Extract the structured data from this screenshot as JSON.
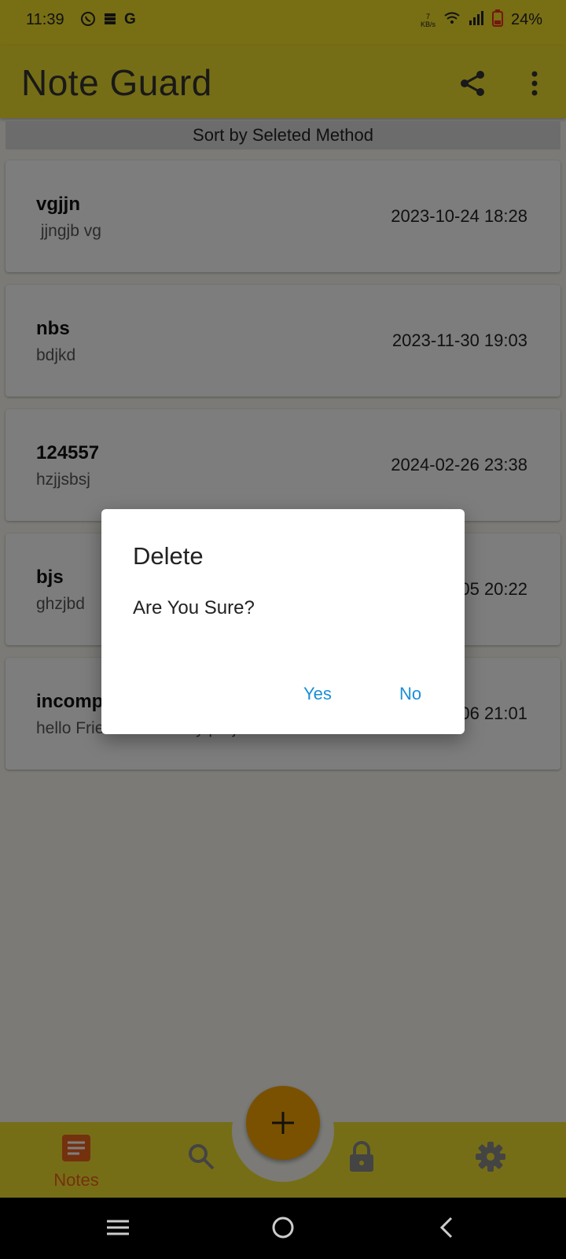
{
  "status_bar": {
    "time": "11:39",
    "left_icons": [
      "whatsapp-icon",
      "storage-icon",
      "google-icon"
    ],
    "net_speed": "7",
    "net_unit": "KB/s",
    "battery": "24%"
  },
  "app_bar": {
    "title": "Note Guard",
    "actions": [
      "share-icon",
      "more-vert-icon"
    ]
  },
  "sort_bar": {
    "label": "Sort by Seleted Method"
  },
  "notes": [
    {
      "title": "vgjjn",
      "body": " jjngjb vg",
      "date": "2023-10-24 18:28"
    },
    {
      "title": "nbs",
      "body": "bdjkd",
      "date": "2023-11-30 19:03"
    },
    {
      "title": "124557",
      "body": "hzjjsbsj",
      "date": "2024-02-26 23:38"
    },
    {
      "title": "bjs",
      "body": "ghzjbd",
      "date": "2024-03-05 20:22"
    },
    {
      "title": "incomplete",
      "body": "hello Friends this is my project",
      "date": "2024-03-06 21:01"
    }
  ],
  "dialog": {
    "title": "Delete",
    "message": "Are You Sure?",
    "yes_label": "Yes",
    "no_label": "No"
  },
  "bottom_nav": {
    "notes_label": "Notes",
    "items": [
      "notes-icon",
      "search-icon",
      "lock-icon",
      "settings-icon"
    ],
    "fab": "add-icon"
  },
  "colors": {
    "accent_yellow": "#eddc2c",
    "fab_orange": "#f5a300",
    "active_orange": "#e8621c",
    "dialog_button_blue": "#1a8fd6"
  }
}
